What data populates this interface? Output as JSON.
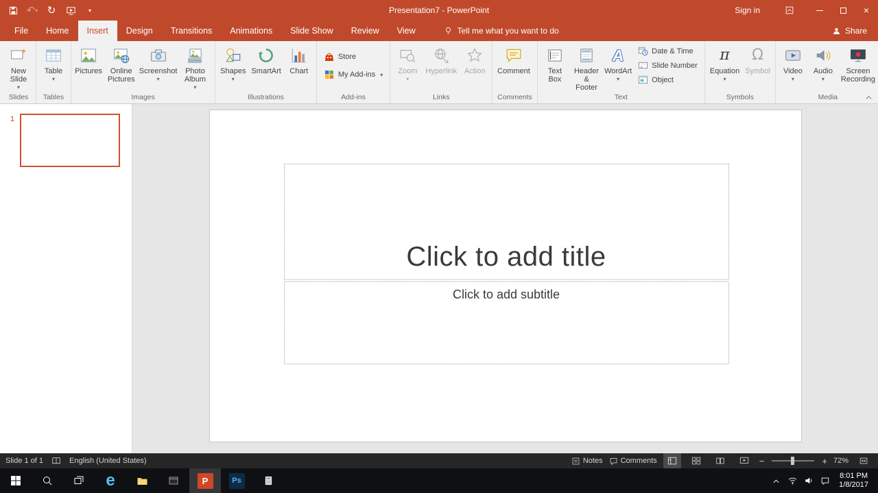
{
  "colors": {
    "accent": "#C0492C",
    "ribbon_bg": "#F1F1F1",
    "statusbar_bg": "#262626",
    "taskbar_bg": "#0E1013"
  },
  "titlebar": {
    "title": "Presentation7 - PowerPoint",
    "sign_in": "Sign in"
  },
  "tabs": {
    "file": "File",
    "home": "Home",
    "insert": "Insert",
    "design": "Design",
    "transitions": "Transitions",
    "animations": "Animations",
    "slide_show": "Slide Show",
    "review": "Review",
    "view": "View",
    "tell_me": "Tell me what you want to do",
    "share": "Share"
  },
  "ribbon": {
    "slides": {
      "label": "Slides",
      "new_slide": "New Slide"
    },
    "tables": {
      "label": "Tables",
      "table": "Table"
    },
    "images": {
      "label": "Images",
      "pictures": "Pictures",
      "online_pictures": "Online Pictures",
      "screenshot": "Screenshot",
      "photo_album": "Photo Album"
    },
    "illustrations": {
      "label": "Illustrations",
      "shapes": "Shapes",
      "smartart": "SmartArt",
      "chart": "Chart"
    },
    "addins": {
      "label": "Add-ins",
      "store": "Store",
      "my_addins": "My Add-ins"
    },
    "links": {
      "label": "Links",
      "zoom": "Zoom",
      "hyperlink": "Hyperlink",
      "action": "Action"
    },
    "comments": {
      "label": "Comments",
      "comment": "Comment"
    },
    "text": {
      "label": "Text",
      "text_box": "Text Box",
      "header_footer": "Header & Footer",
      "wordart": "WordArt",
      "date_time": "Date & Time",
      "slide_number": "Slide Number",
      "object": "Object"
    },
    "symbols": {
      "label": "Symbols",
      "equation": "Equation",
      "symbol": "Symbol"
    },
    "media": {
      "label": "Media",
      "video": "Video",
      "audio": "Audio",
      "screen_recording": "Screen Recording"
    }
  },
  "icons": {
    "dropdown": "▾",
    "undo": "↶",
    "redo": "↻",
    "close": "×",
    "equation": "π",
    "symbol": "Ω",
    "wordart": "A",
    "edge": "e",
    "powerpoint": "P",
    "photoshop": "Ps",
    "minus": "−",
    "plus": "+"
  },
  "slide_panel": {
    "slide_number": "1"
  },
  "slide": {
    "title_placeholder": "Click to add title",
    "subtitle_placeholder": "Click to add subtitle"
  },
  "statusbar": {
    "slide_info": "Slide 1 of 1",
    "language": "English (United States)",
    "notes": "Notes",
    "comments": "Comments",
    "zoom": "72%"
  },
  "taskbar": {
    "time": "8:01 PM",
    "date": "1/8/2017"
  }
}
